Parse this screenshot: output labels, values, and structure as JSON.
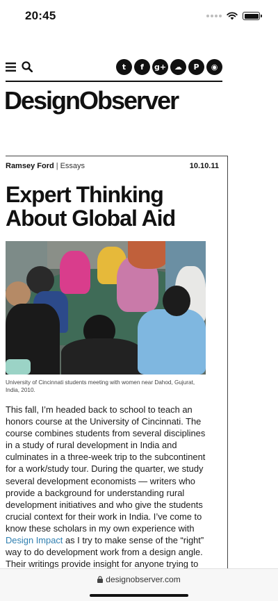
{
  "status": {
    "time": "20:45"
  },
  "header": {
    "menu_icon": "hamburger-icon",
    "search_icon": "search-icon",
    "social": [
      {
        "name": "twitter-icon",
        "glyph": "t"
      },
      {
        "name": "facebook-icon",
        "glyph": "f"
      },
      {
        "name": "googleplus-icon",
        "glyph": "g+"
      },
      {
        "name": "soundcloud-icon",
        "glyph": "☁"
      },
      {
        "name": "pinterest-icon",
        "glyph": "P"
      },
      {
        "name": "rss-icon",
        "glyph": "◉"
      }
    ],
    "brand": "DesignObserver"
  },
  "article": {
    "author": "Ramsey Ford",
    "separator": "|",
    "category": "Essays",
    "date": "10.10.11",
    "title": "Expert Thinking About Global Aid",
    "caption": "University of Cincinnati students meeting with women near Dahod, Gujurat, India, 2010.",
    "body_before_link": "This fall, I’m headed back to school to teach an honors course at the University of Cincinnati. The course combines students from several disciplines in a study of rural development in India and culminates in a three-week trip to the subcontinent for a work/study tour. During the quarter, we study several development economists — writers who provide a background for understanding rural development initiatives and who give the students crucial context for their work in India. I’ve come to know these scholars in my own experience with ",
    "link_text": "Design Impact",
    "body_after_link": " as I try to make sense of the “right” way to do development work from a design angle. Their writings provide insight for anyone trying to"
  },
  "browser": {
    "url": "designobserver.com"
  }
}
